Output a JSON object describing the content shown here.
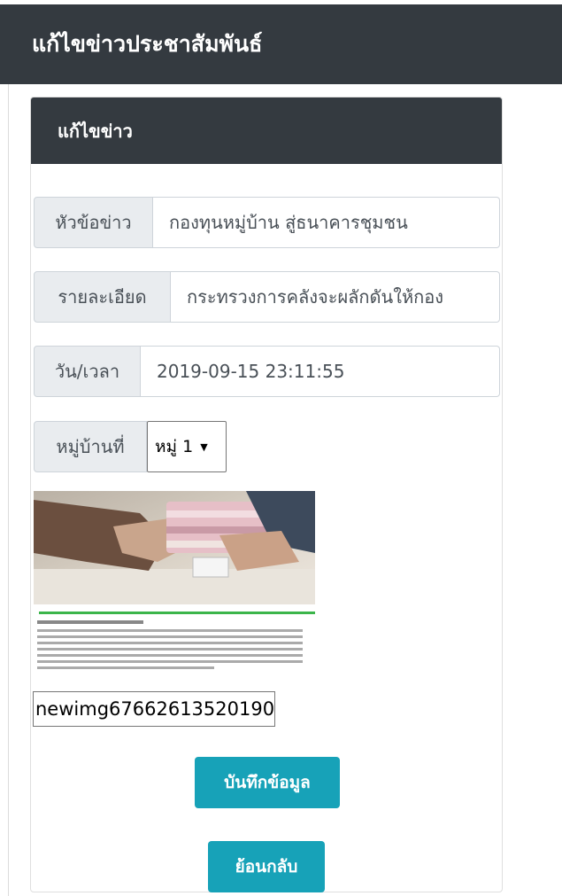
{
  "page": {
    "title": "แก้ไขข่าวประชาสัมพันธ์"
  },
  "card": {
    "header": "แก้ไขข่าว"
  },
  "form": {
    "headline": {
      "label": "หัวข้อข่าว",
      "value": "กองทุนหมู่บ้าน สู่ธนาคารชุมชน"
    },
    "detail": {
      "label": "รายละเอียด",
      "value": "กระทรวงการคลังจะผลักดันให้กอง"
    },
    "datetime": {
      "label": "วัน/เวลา",
      "value": "2019-09-15 23:11:55"
    },
    "village": {
      "label": "หมู่บ้านที่",
      "selected": "หมู่ 1"
    },
    "file": {
      "value": "newimg67662613520190"
    },
    "save_label": "บันทึกข้อมูล",
    "back_label": "ย้อนกลับ"
  },
  "colors": {
    "dark": "#343a40",
    "accent": "#17a2b8",
    "addon": "#e9ecef"
  }
}
